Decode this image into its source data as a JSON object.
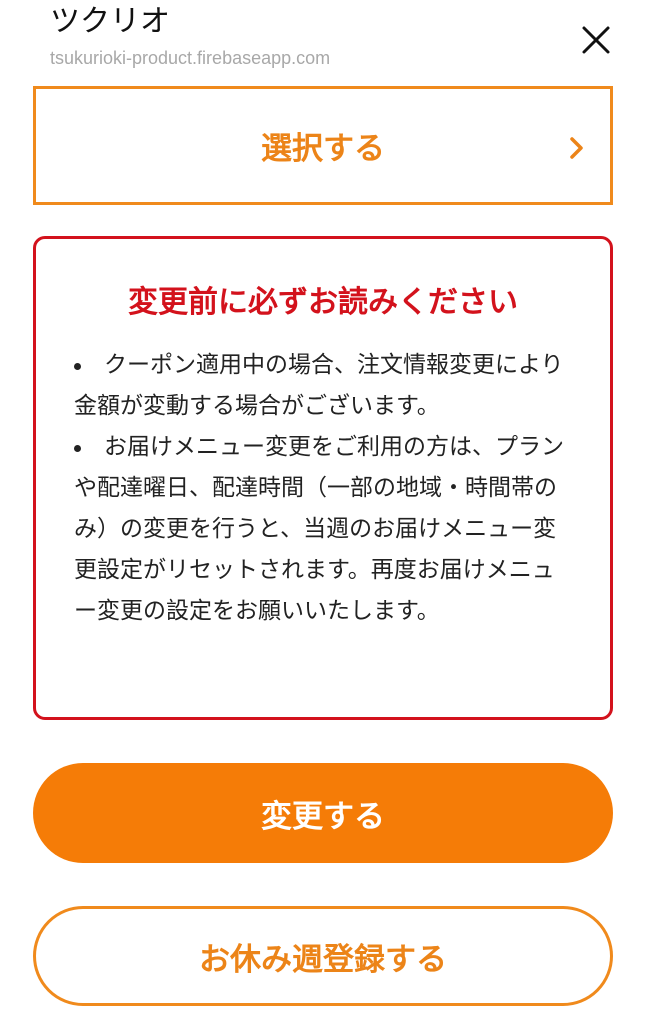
{
  "header": {
    "title": "ツクリオ",
    "url": "tsukurioki-product.firebaseapp.com",
    "close_icon": "close-icon"
  },
  "select_button": {
    "label": "選択する",
    "icon": "chevron-right-icon"
  },
  "notice": {
    "title": "変更前に必ずお読みください",
    "items": [
      "クーポン適用中の場合、注文情報変更により金額が変動する場合がございます。",
      "お届けメニュー変更をご利用の方は、プランや配達曜日、配達時間（一部の地域・時間帯のみ）の変更を行うと、当週のお届けメニュー変更設定がリセットされます。再度お届けメニュー変更の設定をお願いいたします。"
    ]
  },
  "primary_button": {
    "label": "変更する"
  },
  "secondary_button": {
    "label": "お休み週登録する"
  },
  "colors": {
    "accent": "#f57c07",
    "warning": "#d3121c",
    "text": "#222222",
    "muted": "#a8a8a8"
  }
}
